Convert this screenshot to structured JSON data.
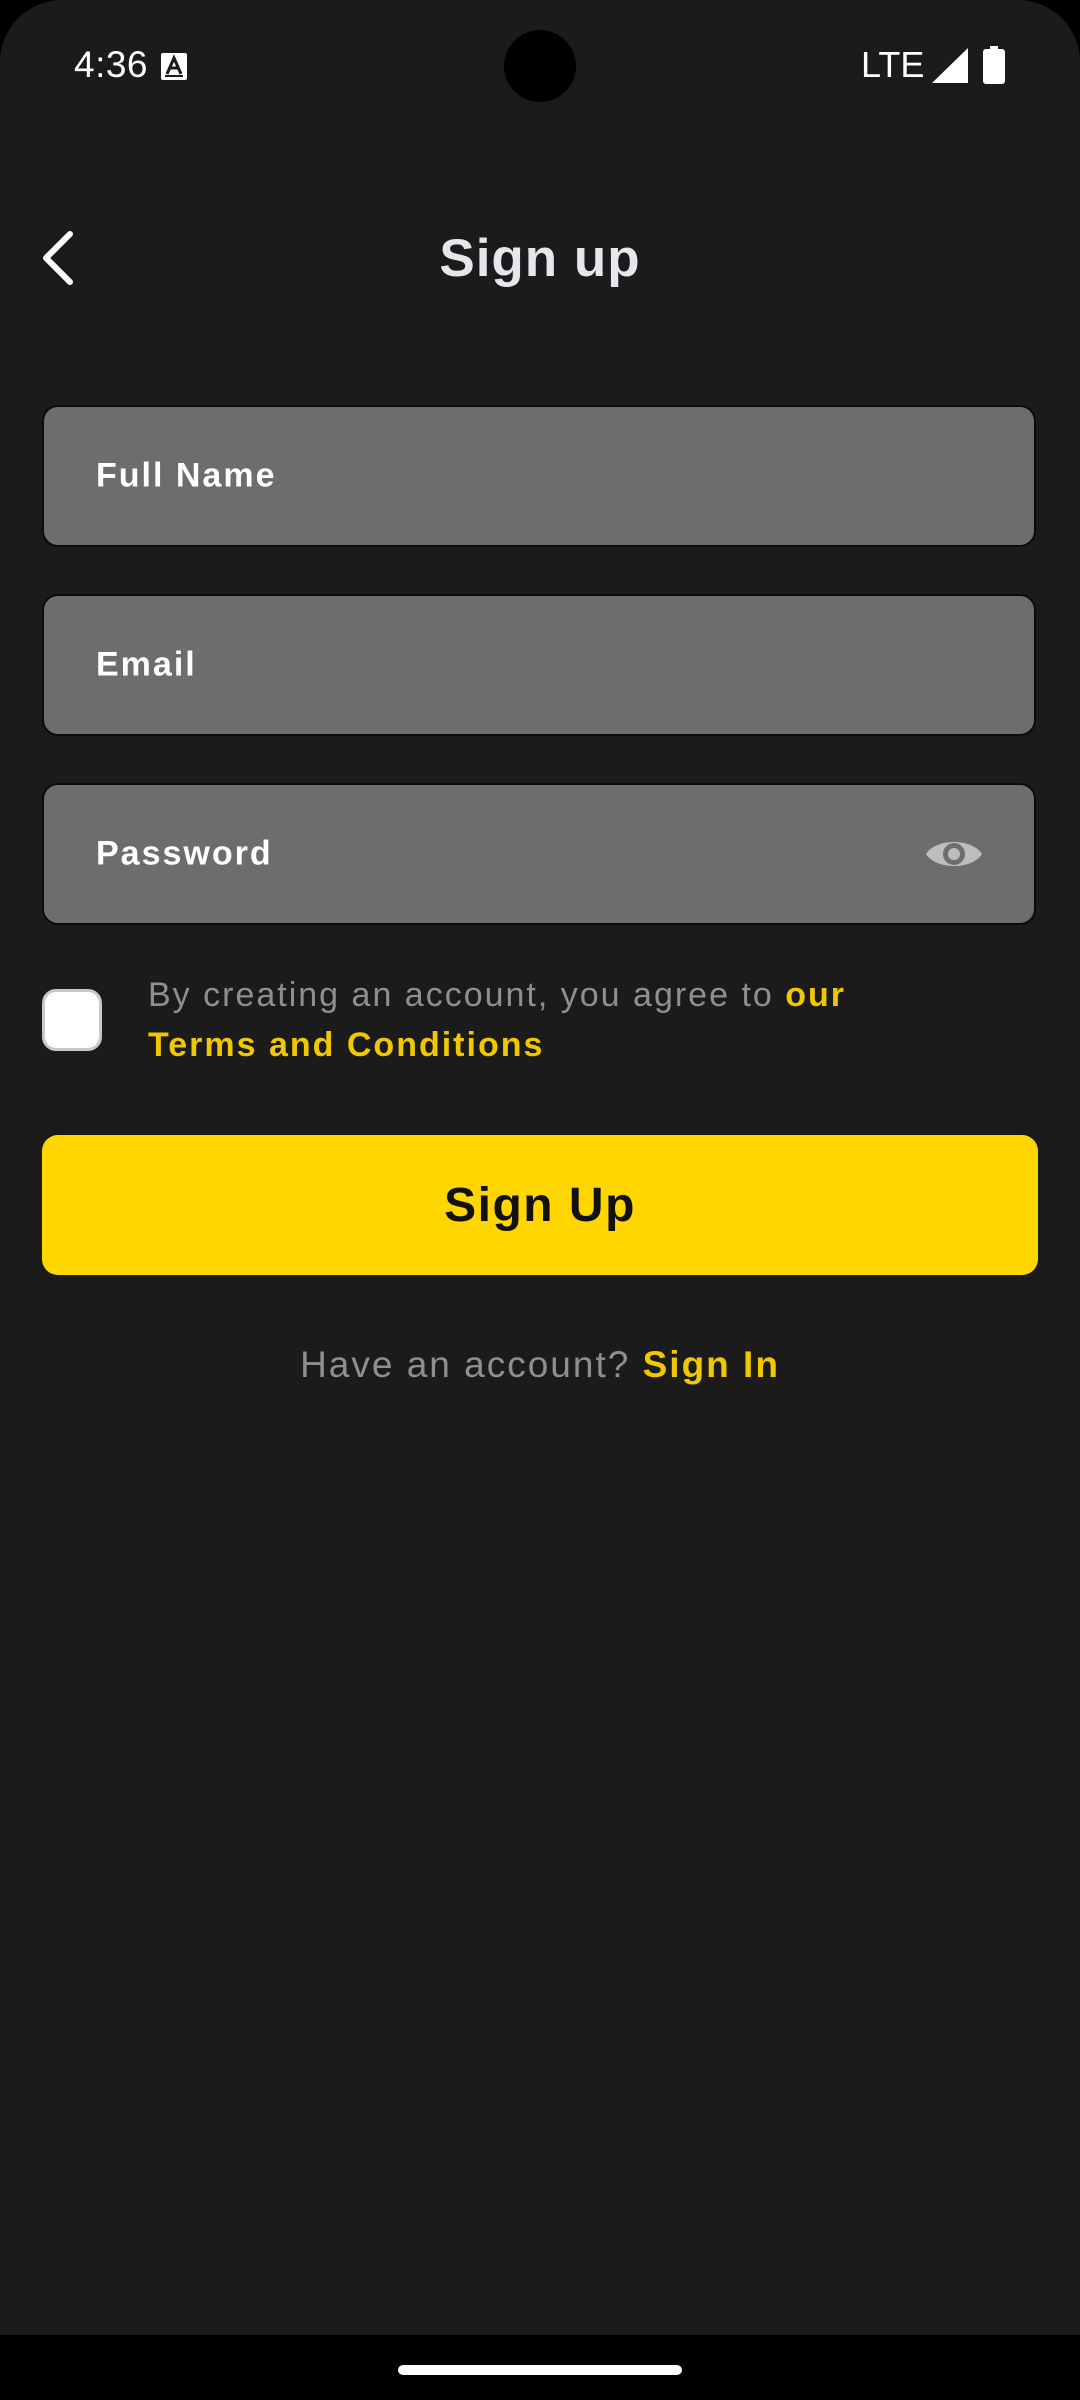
{
  "status_bar": {
    "time": "4:36",
    "network": "LTE",
    "icons": [
      "a-notification-icon",
      "signal-icon",
      "battery-icon"
    ]
  },
  "header": {
    "title": "Sign up",
    "back_icon": "chevron-left-icon"
  },
  "form": {
    "full_name_placeholder": "Full Name",
    "email_placeholder": "Email",
    "password_placeholder": "Password",
    "password_toggle_icon": "eye-icon"
  },
  "terms": {
    "checked": false,
    "text": "By creating an account, you agree to ",
    "link": "our Terms and Conditions"
  },
  "signup_button": {
    "label": "Sign Up"
  },
  "footer": {
    "prompt": "Have an account? ",
    "link": "Sign In"
  },
  "colors": {
    "background": "#1b1b1b",
    "field": "#6d6d6d",
    "accent": "#ffd600",
    "link": "#f1c800",
    "muted_text": "#8f8f8f"
  }
}
